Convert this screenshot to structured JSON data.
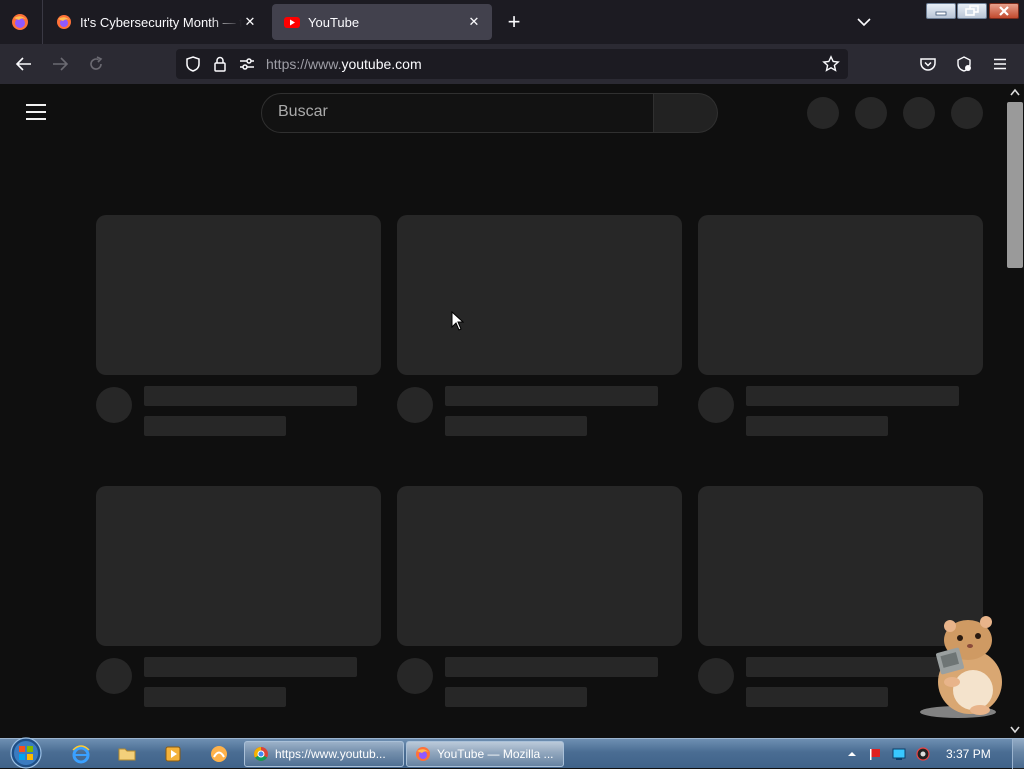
{
  "browser": {
    "tabs": [
      {
        "title": "It's Cybersecurity Month — time",
        "active": false,
        "close": "✕"
      },
      {
        "title": "YouTube",
        "active": true,
        "close": "✕"
      }
    ],
    "new_tab": "+",
    "url_prefix": "https://www.",
    "url_host": "youtube.com",
    "icons": [
      "firefox-menu-icon",
      "chevron-down-icon",
      "back-icon",
      "forward-icon",
      "reload-icon",
      "shield-icon",
      "lock-icon",
      "permissions-icon",
      "bookmark-star-icon",
      "pocket-icon",
      "extensions-icon",
      "app-menu-icon"
    ]
  },
  "youtube": {
    "search_placeholder": "Buscar",
    "header_placeholder_buttons": 4,
    "rows": 2,
    "cards_per_row": 3,
    "state": "loading-skeleton"
  },
  "taskbar": {
    "tasks": [
      {
        "label": "https://www.youtub...",
        "icon": "chrome-icon"
      },
      {
        "label": "YouTube — Mozilla ...",
        "icon": "firefox-icon",
        "active": true
      }
    ],
    "quick_launch": [
      "internet-explorer-icon",
      "explorer-folder-icon",
      "media-player-icon",
      "app-icon"
    ],
    "tray": [
      "tray-expand-icon",
      "flag-icon",
      "network-icon",
      "volume-icon"
    ],
    "clock": "3:37 PM"
  },
  "colors": {
    "page_bg": "#0f0f0f",
    "skeleton": "#272727",
    "tab_active": "#42414d",
    "toolbar": "#2b2a33"
  }
}
